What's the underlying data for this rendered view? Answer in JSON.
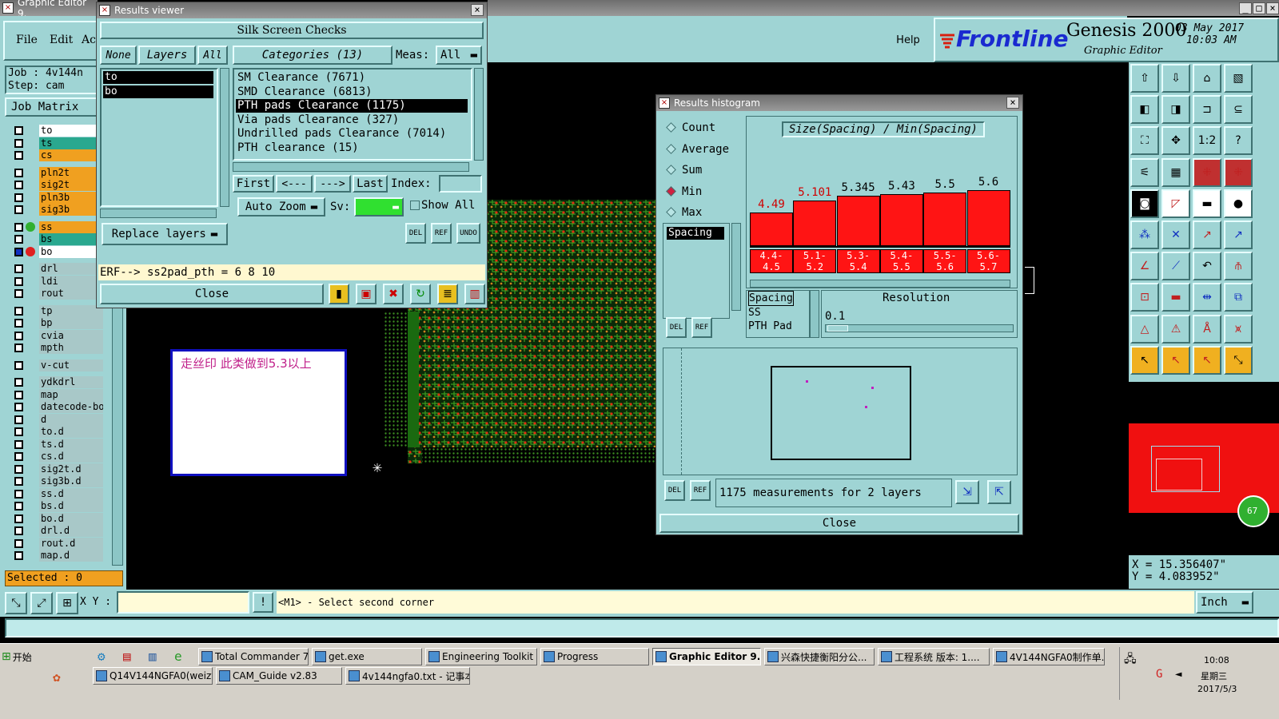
{
  "app": {
    "title": "Graphic Editor 9."
  },
  "menu": [
    "File",
    "Edit",
    "Ac"
  ],
  "job": {
    "job_text": "Job : 4v144n",
    "step_text": "Step: cam",
    "matrix_label": "Job Matrix"
  },
  "layers": [
    {
      "name": "to",
      "color": "#ffffff"
    },
    {
      "name": "ts",
      "color": "#2aa88f"
    },
    {
      "name": "cs",
      "color": "#f0a020"
    },
    {
      "name": "pln2t",
      "color": "#f0a020"
    },
    {
      "name": "sig2t",
      "color": "#f0a020"
    },
    {
      "name": "pln3b",
      "color": "#f0a020"
    },
    {
      "name": "sig3b",
      "color": "#f0a020"
    },
    {
      "name": "ss",
      "color": "#f0a020"
    },
    {
      "name": "bs",
      "color": "#2aa88f"
    },
    {
      "name": "bo",
      "color": "#ffffff"
    },
    {
      "name": "drl",
      "color": "#a8c8c8"
    },
    {
      "name": "ldi",
      "color": "#a8c8c8"
    },
    {
      "name": "rout",
      "color": "#a8c8c8"
    },
    {
      "name": "tp",
      "color": "#a8c8c8"
    },
    {
      "name": "bp",
      "color": "#a8c8c8"
    },
    {
      "name": "cvia",
      "color": "#a8c8c8"
    },
    {
      "name": "mpth",
      "color": "#a8c8c8"
    },
    {
      "name": "v-cut",
      "color": "#a8c8c8"
    },
    {
      "name": "ydkdrl",
      "color": "#a8c8c8"
    },
    {
      "name": "map",
      "color": "#a8c8c8"
    },
    {
      "name": "datecode-bo",
      "color": "#a8c8c8"
    },
    {
      "name": "d",
      "color": "#a8c8c8"
    },
    {
      "name": "to.d",
      "color": "#a8c8c8"
    },
    {
      "name": "ts.d",
      "color": "#a8c8c8"
    },
    {
      "name": "cs.d",
      "color": "#a8c8c8"
    },
    {
      "name": "sig2t.d",
      "color": "#a8c8c8"
    },
    {
      "name": "sig3b.d",
      "color": "#a8c8c8"
    },
    {
      "name": "ss.d",
      "color": "#a8c8c8"
    },
    {
      "name": "bs.d",
      "color": "#a8c8c8"
    },
    {
      "name": "bo.d",
      "color": "#a8c8c8"
    },
    {
      "name": "drl.d",
      "color": "#a8c8c8"
    },
    {
      "name": "rout.d",
      "color": "#a8c8c8"
    },
    {
      "name": "map.d",
      "color": "#a8c8c8"
    }
  ],
  "selected": "Selected : 0",
  "results_viewer": {
    "title": "Results viewer",
    "header": "Silk Screen Checks",
    "filters": {
      "none": "None",
      "layers": "Layers",
      "all": "All"
    },
    "categories_label": "Categories (13)",
    "meas_label": "Meas:",
    "meas_value": "All",
    "layer_list": [
      "to",
      "bo"
    ],
    "categories": [
      "SM Clearance (7671)",
      "SMD Clearance (6813)",
      "PTH pads Clearance (1175)",
      "Via pads Clearance (327)",
      "Undrilled pads Clearance (7014)",
      "PTH clearance (15)"
    ],
    "selected_category": "PTH pads Clearance (1175)",
    "nav": {
      "first": "First",
      "prev": "<---",
      "next": "--->",
      "last": "Last",
      "index": "Index:"
    },
    "auto_zoom": "Auto Zoom",
    "sv_label": "Sv:",
    "show_all": "Show All",
    "replace_layers": "Replace layers",
    "erf": "ERF--> ss2pad_pth = 6 8 10",
    "close": "Close",
    "icons": {
      "del": "DEL",
      "ref": "REF",
      "undo": "UNDO"
    }
  },
  "header": {
    "help": "Help",
    "brand": "Frontline",
    "product": "Genesis 2000",
    "subtitle": "Graphic Editor",
    "date": "03 May 2017",
    "time": "10:03 AM"
  },
  "note": "走丝印 此类做到5.3以上",
  "histogram": {
    "title": "Results histogram",
    "stats": [
      "Count",
      "Average",
      "Sum",
      "Min",
      "Max"
    ],
    "selected_stat": "Min",
    "chart_title": "Size(Spacing) / Min(Spacing)",
    "measure_list": [
      "Spacing"
    ],
    "layer_table": [
      "Spacing",
      "SS",
      "PTH Pad"
    ],
    "resolution_label": "Resolution",
    "resolution_value": "0.1",
    "summary": "1175 measurements for 2 layers",
    "close": "Close"
  },
  "chart_data": {
    "type": "bar",
    "categories": [
      "4.4-4.5",
      "5.1-5.2",
      "5.3-5.4",
      "5.4-5.5",
      "5.5-5.6",
      "5.6-5.7"
    ],
    "range_labels": [
      [
        "4.4-",
        "4.5"
      ],
      [
        "5.1-",
        "5.2"
      ],
      [
        "5.3-",
        "5.4"
      ],
      [
        "5.4-",
        "5.5"
      ],
      [
        "5.5-",
        "5.6"
      ],
      [
        "5.6-",
        "5.7"
      ]
    ],
    "value_labels": [
      "4.49",
      "5.101",
      "5.345",
      "5.43",
      "5.5",
      "5.6"
    ],
    "values": [
      4.49,
      5.101,
      5.345,
      5.43,
      5.5,
      5.6
    ],
    "label_colors": [
      "#d00000",
      "#d00000",
      "#000000",
      "#000000",
      "#000000",
      "#000000"
    ],
    "title": "Size(Spacing) / Min(Spacing)"
  },
  "status": {
    "xy_label": "X Y :",
    "xy_value": "",
    "prompt": "<M1> - Select second corner",
    "units": "Inch",
    "coord_x": "X = 15.356407\"",
    "coord_y": "Y = 4.083952\""
  },
  "taskbar": {
    "start": "开始",
    "row1": [
      "Total Commander 7.0...",
      "get.exe",
      "Engineering Toolkit 9....",
      "Progress",
      "Graphic Editor 9.07...",
      "兴森快捷衡阳分公...",
      "工程系统 版本: 1....",
      "4V144NGFA0制作单...."
    ],
    "row2": [
      "Q14V144NGFA0(weizy)2...",
      "CAM_Guide v2.83",
      "4v144ngfa0.txt - 记事本"
    ],
    "clock_time": "10:08",
    "clock_day": "星期三",
    "clock_date": "2017/5/3"
  },
  "tools": {
    "one_to_one": "1:2",
    "help": "?"
  },
  "badge": "67"
}
